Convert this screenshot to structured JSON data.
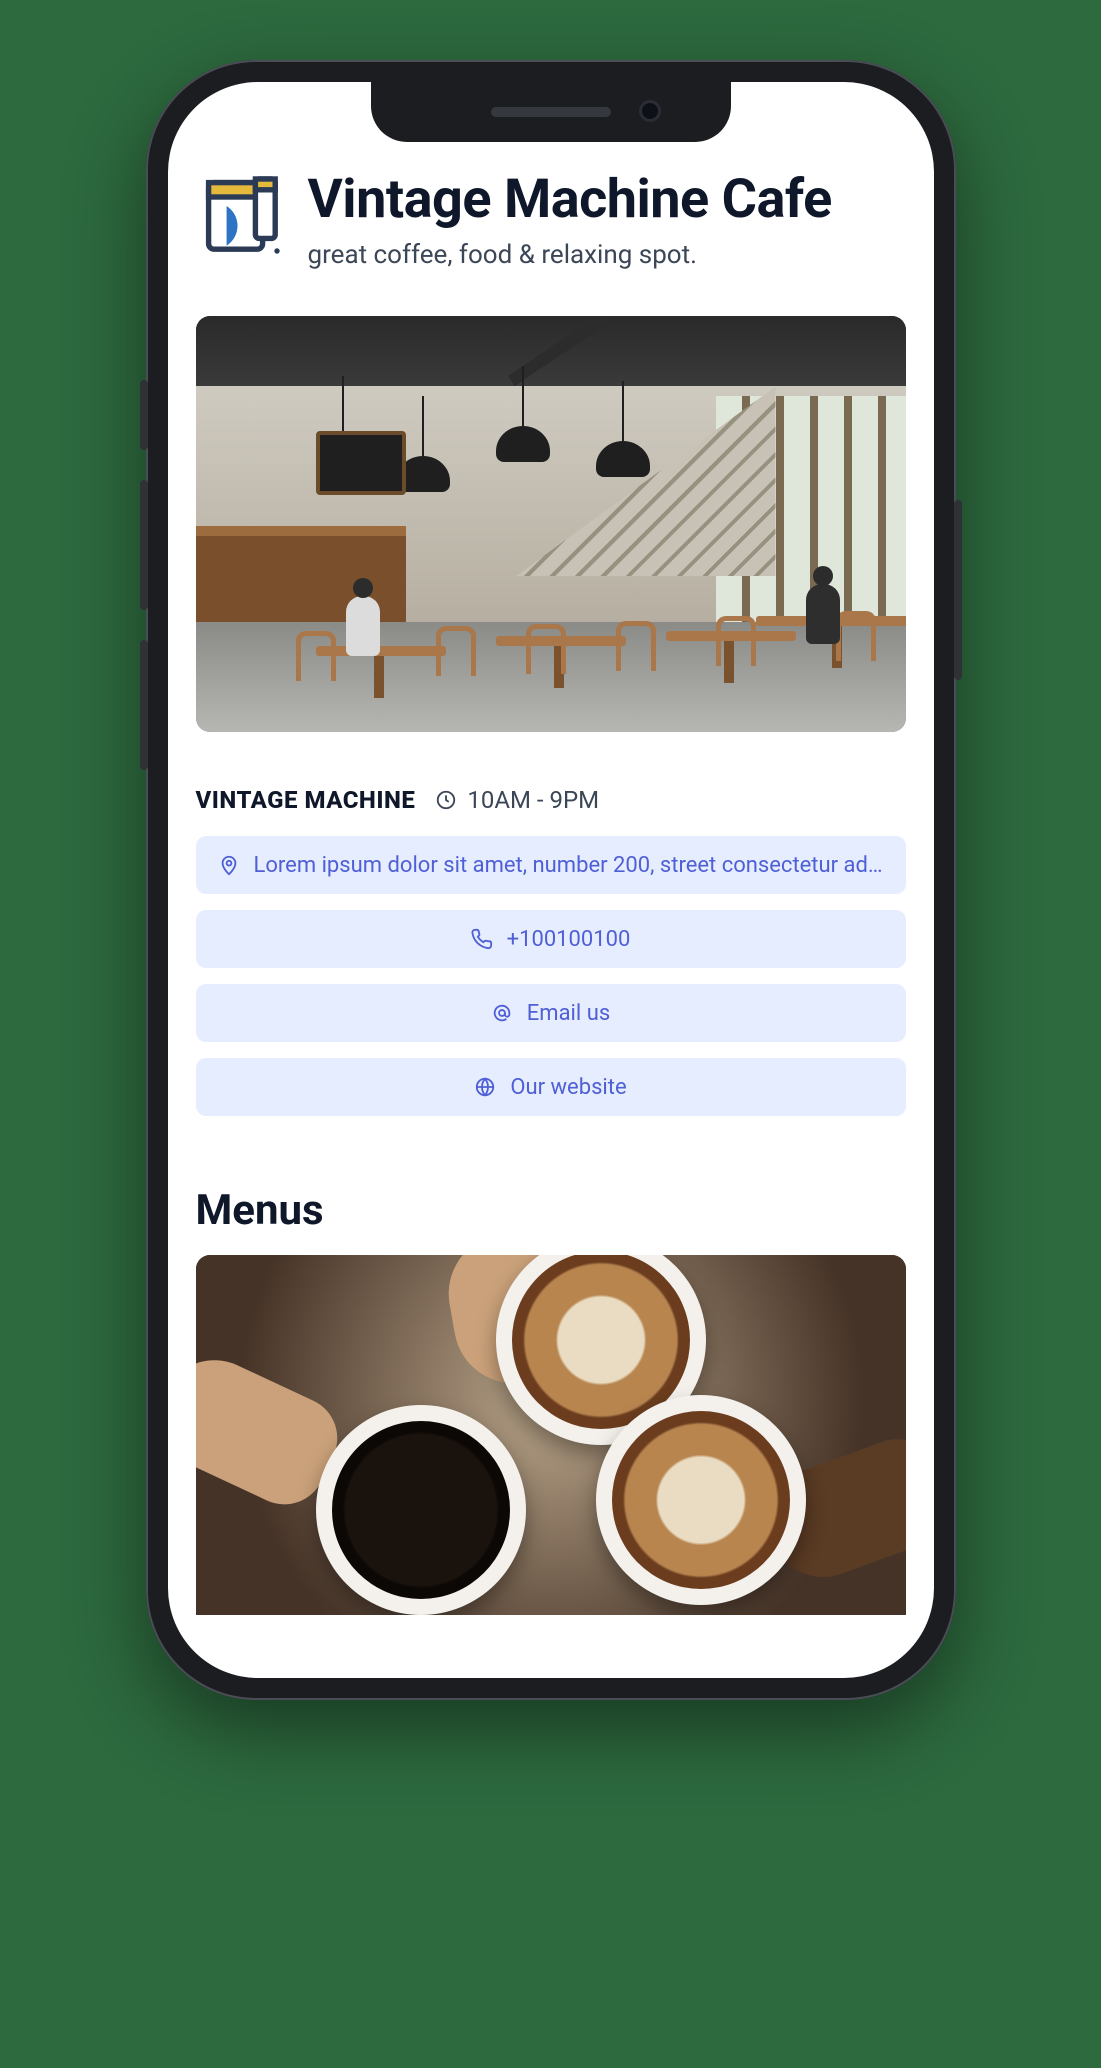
{
  "header": {
    "logo_name": "coffee-cup-icon",
    "title": "Vintage Machine Cafe",
    "subtitle": "great coffee, food & relaxing spot."
  },
  "hero": {
    "alt": "Interior of cafe with wooden tables, pendant lamps and a staircase"
  },
  "info": {
    "name": "VINTAGE MACHINE",
    "hours": "10AM - 9PM"
  },
  "contacts": {
    "address": "Lorem ipsum dolor sit amet, number 200, street consectetur adi...",
    "phone": "+100100100",
    "email_label": "Email us",
    "website_label": "Our website"
  },
  "menus": {
    "heading": "Menus",
    "image_alt": "Three coffee cups with latte art held together"
  },
  "colors": {
    "pill_bg": "#e6edff",
    "pill_fg": "#4f5fd6",
    "text": "#0f172a"
  }
}
